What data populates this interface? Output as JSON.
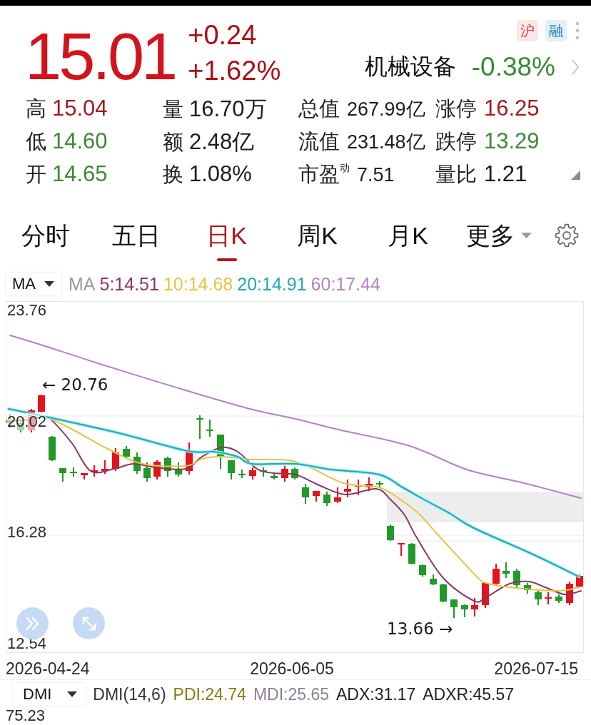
{
  "quote": {
    "price": "15.01",
    "change": "+0.24",
    "change_percent": "+1.62%",
    "color": "#d3131b"
  },
  "badges": [
    {
      "label": "沪",
      "color": "#e0393e"
    },
    {
      "label": "融",
      "color": "#1f7fc0"
    }
  ],
  "sector": {
    "name": "机械设备",
    "change": "-0.38%",
    "color": "#3a8a34"
  },
  "stats": [
    [
      {
        "label": "高",
        "value": "15.04",
        "color": "#a31a1c"
      },
      {
        "label": "量",
        "value": "16.70万",
        "color": "#1c1c1c"
      },
      {
        "label": "总值",
        "value": "267.99亿",
        "color": "#1c1c1c"
      },
      {
        "label": "涨停",
        "value": "16.25",
        "color": "#a31a1c"
      }
    ],
    [
      {
        "label": "低",
        "value": "14.60",
        "color": "#3c8a36"
      },
      {
        "label": "额",
        "value": "2.48亿",
        "color": "#1c1c1c"
      },
      {
        "label": "流值",
        "value": "231.48亿",
        "color": "#1c1c1c"
      },
      {
        "label": "跌停",
        "value": "13.29",
        "color": "#3c8a36"
      }
    ],
    [
      {
        "label": "开",
        "value": "14.65",
        "color": "#3c8a36"
      },
      {
        "label": "换",
        "value": "1.08%",
        "color": "#1c1c1c"
      },
      {
        "label": "市盈$^{动}$",
        "value": "7.51",
        "color": "#1c1c1c"
      },
      {
        "label": "量比",
        "value": "1.21",
        "color": "#1c1c1c"
      }
    ]
  ],
  "tabs": [
    {
      "label": "分时",
      "selected": false,
      "dropdown": false
    },
    {
      "label": "五日",
      "selected": false,
      "dropdown": false
    },
    {
      "label": "日K",
      "selected": true,
      "dropdown": false
    },
    {
      "label": "周K",
      "selected": false,
      "dropdown": false
    },
    {
      "label": "月K",
      "selected": false,
      "dropdown": false
    },
    {
      "label": "更多",
      "selected": false,
      "dropdown": true
    }
  ],
  "indicator_bar": {
    "selector": "MA",
    "name": "MA",
    "items": [
      {
        "label": "5:14.51",
        "color": "#8c3565"
      },
      {
        "label": "10:14.68",
        "color": "#e5c445"
      },
      {
        "label": "20:14.91",
        "color": "#22a8b4"
      },
      {
        "label": "60:17.44",
        "color": "#b184c2"
      }
    ]
  },
  "chart": {
    "y_labels": [
      "23.76",
      "20.02",
      "16.28",
      "12.54"
    ],
    "annotations": [
      "← 20.76",
      "13.66 →"
    ],
    "x_labels": [
      "2026-04-24",
      "2026-06-05",
      "2026-07-15"
    ]
  },
  "dmi_bar": {
    "selector": "DMI",
    "name": "DMI(14,6)",
    "items": [
      {
        "label": "PDI:24.74",
        "color": "#8a7814"
      },
      {
        "label": "MDI:25.65",
        "color": "#8e8096"
      },
      {
        "label": "ADX:31.17",
        "color": "#222222"
      },
      {
        "label": "ADXR:45.57",
        "color": "#222222"
      }
    ]
  },
  "dmi_chart": {
    "y_labels": [
      "75.23"
    ]
  }
}
